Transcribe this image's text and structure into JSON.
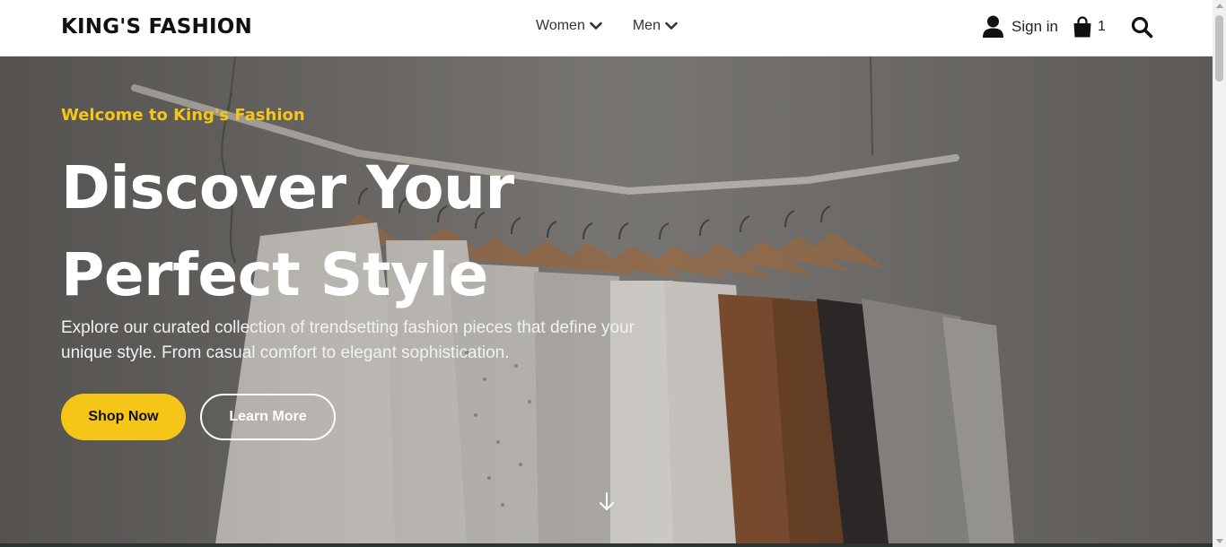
{
  "header": {
    "brand": "KING'S FASHION",
    "nav": [
      {
        "label": "Women",
        "icon": "chevron-down-icon"
      },
      {
        "label": "Men",
        "icon": "chevron-down-icon"
      }
    ],
    "signin_label": "Sign in",
    "signin_icon": "user-icon",
    "cart_icon": "shopping-bag-icon",
    "cart_count": "1",
    "search_icon": "search-icon"
  },
  "hero": {
    "eyebrow": "Welcome to King's Fashion",
    "headline": "Discover Your Perfect Style",
    "subtitle": "Explore our curated collection of trendsetting fashion pieces that define your unique style. From casual comfort to elegant sophistication.",
    "primary_button": "Shop Now",
    "secondary_button": "Learn More",
    "scroll_icon": "arrow-down-icon",
    "background": "clothes-rack-photo"
  },
  "colors": {
    "accent": "#f5c518",
    "text_dark": "#111111",
    "hero_text": "#ffffff"
  }
}
